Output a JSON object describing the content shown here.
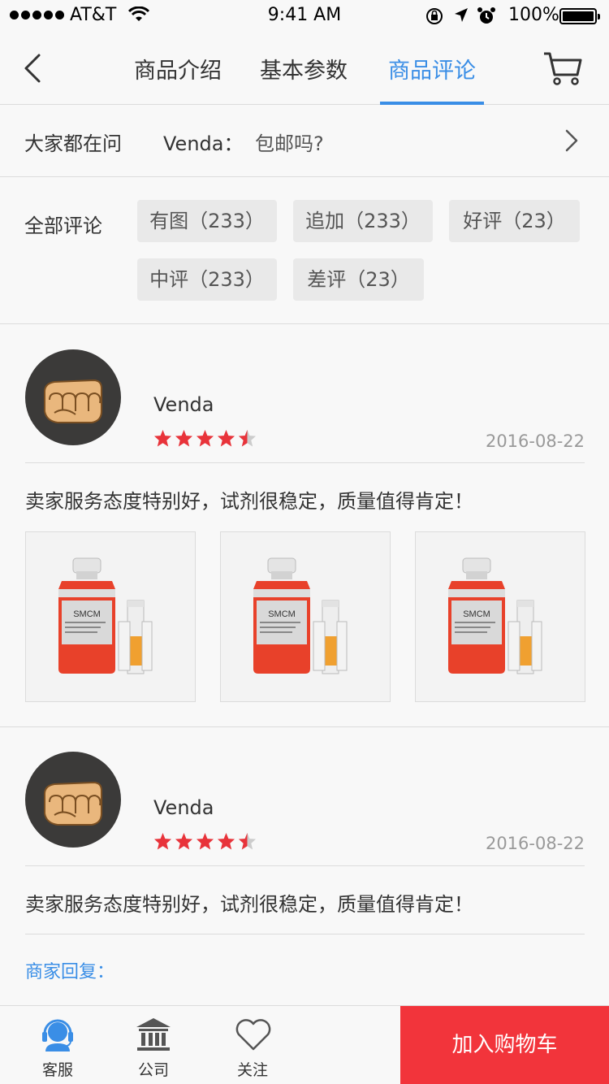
{
  "status_bar": {
    "carrier": "AT&T",
    "time": "9:41 AM",
    "battery": "100%",
    "signal_dots": 5,
    "icons": [
      "wifi-icon",
      "rotation-lock-icon",
      "location-icon",
      "alarm-icon",
      "battery-icon"
    ]
  },
  "nav": {
    "back_icon": "chevron-left-icon",
    "tabs": [
      "商品介绍",
      "基本参数",
      "商品评论"
    ],
    "active_tab": 2,
    "cart_icon": "cart-icon",
    "accent_color": "#3a8ee6"
  },
  "qa": {
    "label": "大家都在问",
    "user": "Venda：",
    "question": "包邮吗?"
  },
  "filters": {
    "label": "全部评论",
    "chips": [
      "有图（233）",
      "追加（233）",
      "好评（23）",
      "中评（233）",
      "差评（23）"
    ]
  },
  "reviews": [
    {
      "user": "Venda",
      "rating": 4.5,
      "date": "2016-08-22",
      "text": "卖家服务态度特别好，试剂很稳定，质量值得肯定！",
      "photos": [
        {
          "bottle_label": "SMCM"
        },
        {
          "bottle_label": "SMCM"
        },
        {
          "bottle_label": "SMCM"
        }
      ]
    },
    {
      "user": "Venda",
      "rating": 4.5,
      "date": "2016-08-22",
      "text": "卖家服务态度特别好，试剂很稳定，质量值得肯定！",
      "reply_label": "商家回复："
    }
  ],
  "star_color": "#e8333a",
  "bottom_bar": {
    "items": [
      {
        "label": "客服",
        "icon": "customer-service-icon"
      },
      {
        "label": "公司",
        "icon": "bank-building-icon"
      },
      {
        "label": "关注",
        "icon": "heart-icon"
      }
    ],
    "add_to_cart": "加入购物车",
    "add_to_cart_color": "#f2343b"
  }
}
